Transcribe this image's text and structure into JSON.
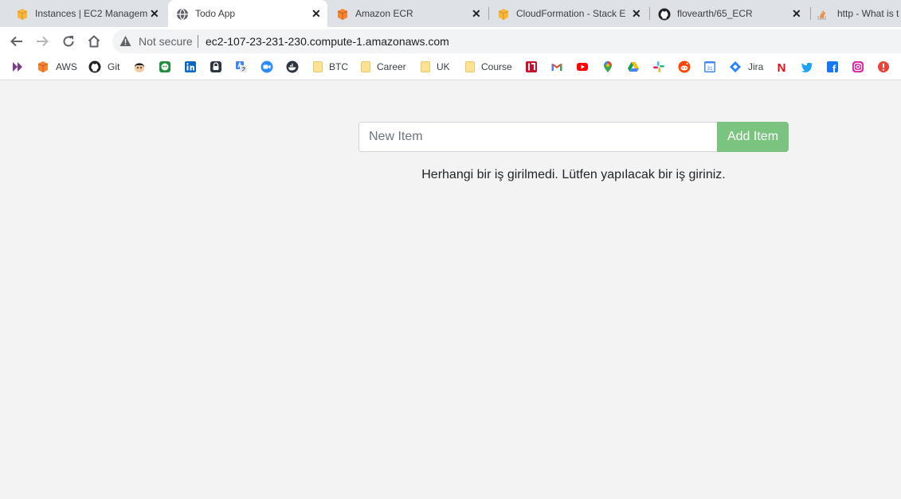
{
  "tabs": [
    {
      "label": "Instances | EC2 Managem",
      "close": "✕",
      "icon": "aws-box-icon"
    },
    {
      "label": "Todo App",
      "close": "✕",
      "icon": "globe-icon",
      "active": true
    },
    {
      "label": "Amazon ECR",
      "close": "✕",
      "icon": "aws-ecr-icon"
    },
    {
      "label": "CloudFormation - Stack E",
      "close": "✕",
      "icon": "aws-box-icon"
    },
    {
      "label": "flovearth/65_ECR",
      "close": "✕",
      "icon": "github-icon"
    },
    {
      "label": "http - What is t",
      "icon": "stackoverflow-icon"
    }
  ],
  "address": {
    "security_label": "Not secure",
    "url": "ec2-107-23-231-230.compute-1.amazonaws.com"
  },
  "bookmarks": [
    {
      "label": "",
      "icon": "chevron-logo-icon"
    },
    {
      "label": "AWS",
      "icon": "aws-icon"
    },
    {
      "label": "Git",
      "icon": "github-icon"
    },
    {
      "label": "",
      "icon": "avatar-icon"
    },
    {
      "label": "",
      "icon": "green-face-icon"
    },
    {
      "label": "",
      "icon": "linkedin-icon"
    },
    {
      "label": "",
      "icon": "lock-app-icon"
    },
    {
      "label": "",
      "icon": "translate-icon"
    },
    {
      "label": "",
      "icon": "zoom-icon"
    },
    {
      "label": "",
      "icon": "docker-icon"
    },
    {
      "label": "BTC",
      "icon": "folder-icon"
    },
    {
      "label": "Career",
      "icon": "folder-icon"
    },
    {
      "label": "UK",
      "icon": "folder-icon"
    },
    {
      "label": "Course",
      "icon": "folder-icon"
    },
    {
      "label": "",
      "icon": "red-tool-icon"
    },
    {
      "label": "",
      "icon": "gmail-icon"
    },
    {
      "label": "",
      "icon": "youtube-icon"
    },
    {
      "label": "",
      "icon": "maps-icon"
    },
    {
      "label": "",
      "icon": "drive-icon"
    },
    {
      "label": "",
      "icon": "slack-icon"
    },
    {
      "label": "",
      "icon": "reddit-icon"
    },
    {
      "label": "",
      "icon": "calendar-icon"
    },
    {
      "label": "Jira",
      "icon": "jira-icon"
    },
    {
      "label": "",
      "icon": "netflix-icon"
    },
    {
      "label": "",
      "icon": "twitter-icon"
    },
    {
      "label": "",
      "icon": "facebook-icon"
    },
    {
      "label": "",
      "icon": "instagram-icon"
    },
    {
      "label": "",
      "icon": "alert-icon"
    }
  ],
  "calendar_day": "31",
  "netflix_letter": "N",
  "facebook_letter": "f",
  "todo": {
    "input_placeholder": "New Item",
    "add_button": "Add Item",
    "empty_message": "Herhangi bir iş girilmedi. Lütfen yapılacak bir iş giriniz."
  },
  "colors": {
    "add_button": "#7bc47f",
    "page_background": "#f3f3f3",
    "tabstrip": "#dee1e6"
  }
}
